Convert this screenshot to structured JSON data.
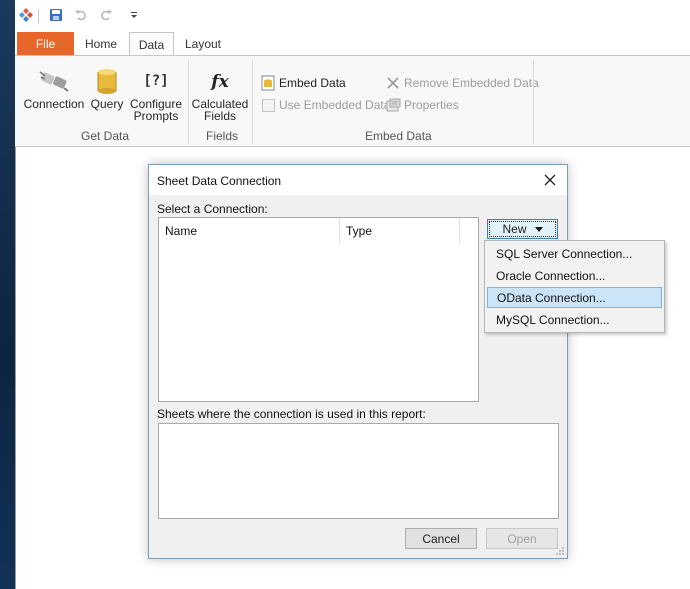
{
  "quick_access": {
    "icons": [
      "app-logo-icon",
      "save-icon",
      "undo-icon",
      "redo-icon",
      "customize-qat-icon"
    ]
  },
  "tabs": [
    {
      "label": "File"
    },
    {
      "label": "Home"
    },
    {
      "label": "Data"
    },
    {
      "label": "Layout"
    }
  ],
  "ribbon": {
    "get_data": {
      "group_label": "Get Data",
      "connection": "Connection",
      "query": "Query",
      "configure_line1": "Configure",
      "configure_line2": "Prompts"
    },
    "fields": {
      "group_label": "Fields",
      "calc_line1": "Calculated",
      "calc_line2": "Fields"
    },
    "embed_data": {
      "group_label": "Embed Data",
      "embed": "Embed Data",
      "use_embedded": "Use Embedded Data",
      "remove_embedded": "Remove Embedded Data",
      "properties": "Properties"
    }
  },
  "dialog": {
    "title": "Sheet Data Connection",
    "select_label": "Select a Connection:",
    "columns": [
      "Name",
      "Type"
    ],
    "new_button": "New",
    "sheets_label": "Sheets where the connection is used in this report:",
    "cancel": "Cancel",
    "open": "Open"
  },
  "new_menu": {
    "items": [
      {
        "label": "SQL Server Connection..."
      },
      {
        "label": "Oracle Connection..."
      },
      {
        "label": "OData Connection..."
      },
      {
        "label": "MySQL Connection..."
      }
    ],
    "highlighted_index": 2
  },
  "colors": {
    "file_tab": "#e8662a",
    "menu_highlight": "#cce4f7",
    "accent_border": "#3c7fb1"
  }
}
